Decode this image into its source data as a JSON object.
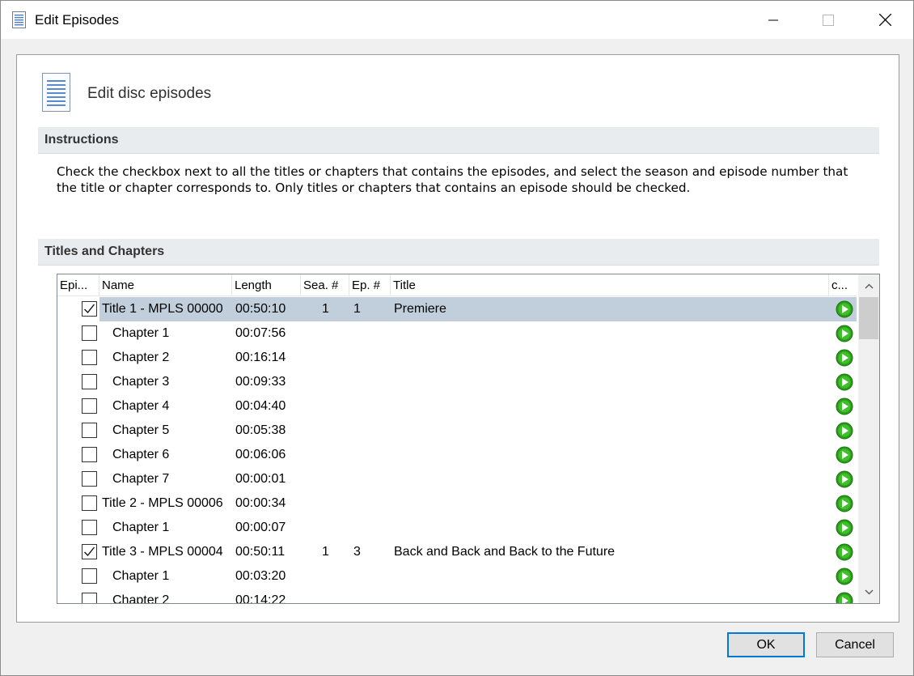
{
  "window": {
    "title": "Edit Episodes"
  },
  "header": {
    "title": "Edit disc episodes"
  },
  "instructions": {
    "heading": "Instructions",
    "line1": "Check the checkbox next to all the titles or chapters that contains the episodes, and select the season and episode number that",
    "line2": "the title or chapter corresponds to. Only titles or chapters that contains an episode should be checked."
  },
  "titles_section": {
    "heading": "Titles and Chapters"
  },
  "columns": [
    "Epi...",
    "Name",
    "Length",
    "Sea. #",
    "Ep. #",
    "Title",
    "c..."
  ],
  "rows": [
    {
      "checked": true,
      "name": "Title 1 - MPLS 00000",
      "length": "00:50:10",
      "season": "1",
      "episode": "1",
      "title": "Premiere",
      "indent": false,
      "selected": true
    },
    {
      "checked": false,
      "name": "Chapter 1",
      "length": "00:07:56",
      "season": "",
      "episode": "",
      "title": "",
      "indent": true,
      "selected": false
    },
    {
      "checked": false,
      "name": "Chapter 2",
      "length": "00:16:14",
      "season": "",
      "episode": "",
      "title": "",
      "indent": true,
      "selected": false
    },
    {
      "checked": false,
      "name": "Chapter 3",
      "length": "00:09:33",
      "season": "",
      "episode": "",
      "title": "",
      "indent": true,
      "selected": false
    },
    {
      "checked": false,
      "name": "Chapter 4",
      "length": "00:04:40",
      "season": "",
      "episode": "",
      "title": "",
      "indent": true,
      "selected": false
    },
    {
      "checked": false,
      "name": "Chapter 5",
      "length": "00:05:38",
      "season": "",
      "episode": "",
      "title": "",
      "indent": true,
      "selected": false
    },
    {
      "checked": false,
      "name": "Chapter 6",
      "length": "00:06:06",
      "season": "",
      "episode": "",
      "title": "",
      "indent": true,
      "selected": false
    },
    {
      "checked": false,
      "name": "Chapter 7",
      "length": "00:00:01",
      "season": "",
      "episode": "",
      "title": "",
      "indent": true,
      "selected": false
    },
    {
      "checked": false,
      "name": "Title 2 - MPLS 00006",
      "length": "00:00:34",
      "season": "",
      "episode": "",
      "title": "",
      "indent": false,
      "selected": false
    },
    {
      "checked": false,
      "name": "Chapter 1",
      "length": "00:00:07",
      "season": "",
      "episode": "",
      "title": "",
      "indent": true,
      "selected": false
    },
    {
      "checked": true,
      "name": "Title 3 - MPLS 00004",
      "length": "00:50:11",
      "season": "1",
      "episode": "3",
      "title": "Back and Back and Back to the Future",
      "indent": false,
      "selected": false
    },
    {
      "checked": false,
      "name": "Chapter 1",
      "length": "00:03:20",
      "season": "",
      "episode": "",
      "title": "",
      "indent": true,
      "selected": false
    },
    {
      "checked": false,
      "name": "Chapter 2",
      "length": "00:14:22",
      "season": "",
      "episode": "",
      "title": "",
      "indent": true,
      "selected": false
    }
  ],
  "buttons": {
    "ok": "OK",
    "cancel": "Cancel"
  },
  "icons": {
    "app": "document-list-icon",
    "header": "document-list-icon",
    "play": "play-icon"
  },
  "colors": {
    "selected_row": "#c1cfdc",
    "play_green": "#2a9d1a",
    "default_button_border": "#0078d7"
  }
}
